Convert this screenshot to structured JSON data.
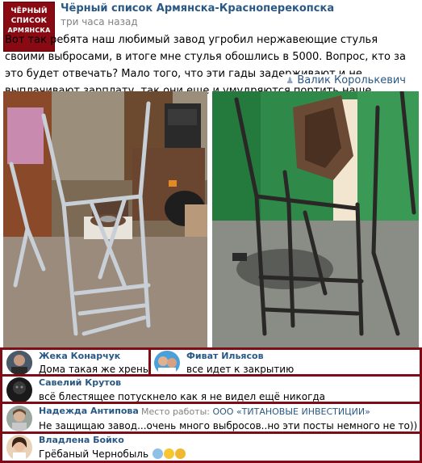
{
  "group": {
    "logo_lines": [
      "ЧЁРНЫЙ",
      "СПИСОК",
      "АРМЯНСКА"
    ],
    "name": "Чёрный список Армянска-Красноперекопска",
    "time": "три часа назад"
  },
  "post": {
    "text": "Вот так ребята наш любимый завод угробил нержавеющие стулья своими выбросами, в итоге мне стулья обошлись в 5000. Вопрос, кто за это будет отвечать? Мало того, что эти гады задерживают и не выплачивают зарплату, так они еще и умудряются портить наше имущество...",
    "author": "Валик Королькевич"
  },
  "comments": [
    {
      "name": "Жека Конарчук",
      "text": "Дома такая же хрень"
    },
    {
      "name": "Фиват Ильясов",
      "text": "все идет к закрытию"
    },
    {
      "name": "Савелий Крутов",
      "text": "всё блестящее потускнело как я не видел ещё никогда"
    },
    {
      "name": "Надежда Антипова",
      "work_label": "Место работы:",
      "work_value": "ООО «ТИТАНОВЫЕ ИНВЕСТИЦИИ»",
      "text": "Не защищаю завод...очень много выбросов..но эти посты немного не то))"
    },
    {
      "name": "Владлена Бойко",
      "text": "Грёбаный Чернобыль"
    }
  ],
  "colors": {
    "frame": "#7e0c16",
    "link": "#2a5885",
    "muted": "#828282"
  }
}
